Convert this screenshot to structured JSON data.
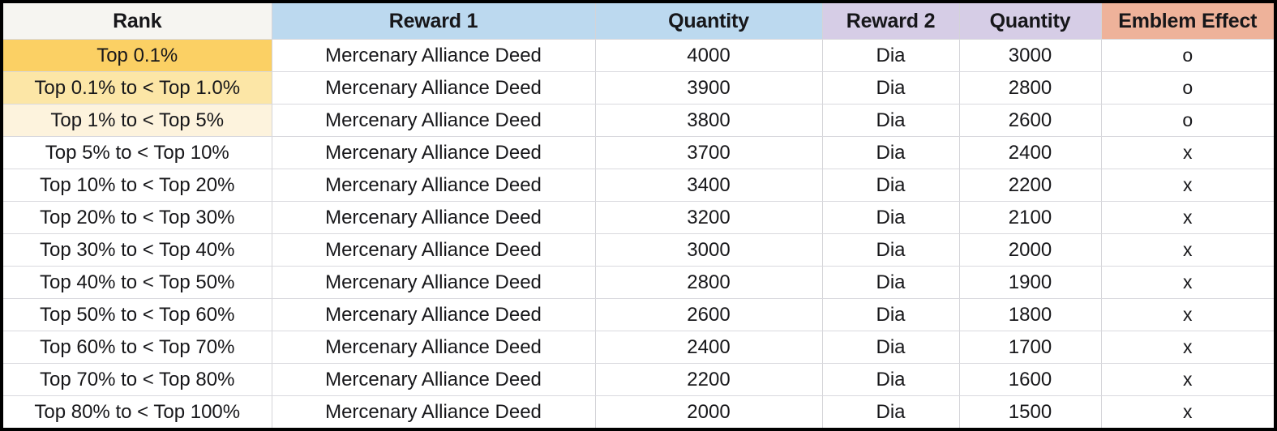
{
  "table": {
    "columns": [
      {
        "key": "rank",
        "label": "Rank",
        "header_color": "#f6f5f1"
      },
      {
        "key": "reward1",
        "label": "Reward 1",
        "header_color": "#bcd9ef"
      },
      {
        "key": "quantity1",
        "label": "Quantity",
        "header_color": "#bcd9ef"
      },
      {
        "key": "reward2",
        "label": "Reward 2",
        "header_color": "#d6cde6"
      },
      {
        "key": "quantity2",
        "label": "Quantity",
        "header_color": "#d6cde6"
      },
      {
        "key": "emblem",
        "label": "Emblem Effect",
        "header_color": "#eeb29a"
      }
    ],
    "rank_tier_colors": {
      "tier_1": "#fbd064",
      "tier_2": "#fce6a6",
      "tier_3": "#fdf3dd",
      "default": "#ffffff"
    },
    "rows": [
      {
        "rank": "Top 0.1%",
        "reward1": "Mercenary Alliance Deed",
        "quantity1": "4000",
        "reward2": "Dia",
        "quantity2": "3000",
        "emblem": "o",
        "rank_tier": "tier-1"
      },
      {
        "rank": "Top 0.1% to < Top 1.0%",
        "reward1": "Mercenary Alliance Deed",
        "quantity1": "3900",
        "reward2": "Dia",
        "quantity2": "2800",
        "emblem": "o",
        "rank_tier": "tier-2"
      },
      {
        "rank": "Top 1% to < Top 5%",
        "reward1": "Mercenary Alliance Deed",
        "quantity1": "3800",
        "reward2": "Dia",
        "quantity2": "2600",
        "emblem": "o",
        "rank_tier": "tier-3"
      },
      {
        "rank": "Top 5% to < Top 10%",
        "reward1": "Mercenary Alliance Deed",
        "quantity1": "3700",
        "reward2": "Dia",
        "quantity2": "2400",
        "emblem": "x",
        "rank_tier": ""
      },
      {
        "rank": "Top 10% to < Top 20%",
        "reward1": "Mercenary Alliance Deed",
        "quantity1": "3400",
        "reward2": "Dia",
        "quantity2": "2200",
        "emblem": "x",
        "rank_tier": ""
      },
      {
        "rank": "Top 20% to < Top 30%",
        "reward1": "Mercenary Alliance Deed",
        "quantity1": "3200",
        "reward2": "Dia",
        "quantity2": "2100",
        "emblem": "x",
        "rank_tier": ""
      },
      {
        "rank": "Top 30% to < Top 40%",
        "reward1": "Mercenary Alliance Deed",
        "quantity1": "3000",
        "reward2": "Dia",
        "quantity2": "2000",
        "emblem": "x",
        "rank_tier": ""
      },
      {
        "rank": "Top 40% to < Top 50%",
        "reward1": "Mercenary Alliance Deed",
        "quantity1": "2800",
        "reward2": "Dia",
        "quantity2": "1900",
        "emblem": "x",
        "rank_tier": ""
      },
      {
        "rank": "Top 50% to < Top 60%",
        "reward1": "Mercenary Alliance Deed",
        "quantity1": "2600",
        "reward2": "Dia",
        "quantity2": "1800",
        "emblem": "x",
        "rank_tier": ""
      },
      {
        "rank": "Top 60% to < Top 70%",
        "reward1": "Mercenary Alliance Deed",
        "quantity1": "2400",
        "reward2": "Dia",
        "quantity2": "1700",
        "emblem": "x",
        "rank_tier": ""
      },
      {
        "rank": "Top 70% to < Top 80%",
        "reward1": "Mercenary Alliance Deed",
        "quantity1": "2200",
        "reward2": "Dia",
        "quantity2": "1600",
        "emblem": "x",
        "rank_tier": ""
      },
      {
        "rank": "Top 80% to < Top 100%",
        "reward1": "Mercenary Alliance Deed",
        "quantity1": "2000",
        "reward2": "Dia",
        "quantity2": "1500",
        "emblem": "x",
        "rank_tier": ""
      }
    ]
  }
}
